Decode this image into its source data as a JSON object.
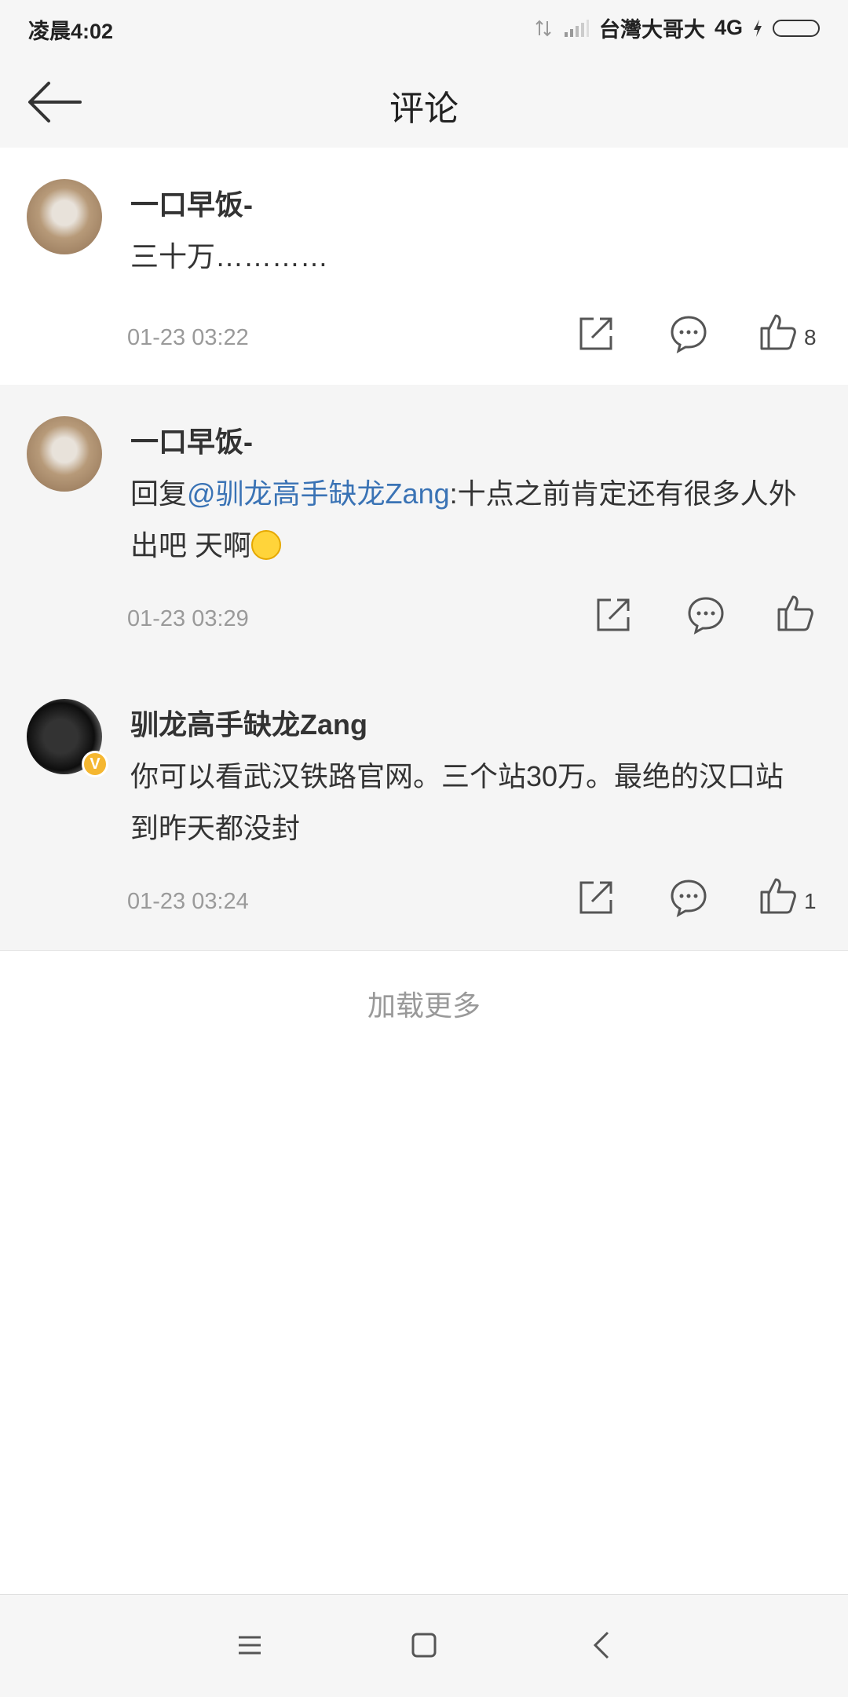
{
  "status_bar": {
    "time": "凌晨4:02",
    "carrier": "台灣大哥大",
    "network": "4G"
  },
  "header": {
    "title": "评论",
    "back_icon": "back-arrow-icon"
  },
  "comments": [
    {
      "username": "一口早饭-",
      "text": "三十万…………",
      "mention": "",
      "timestamp": "01-23 03:22",
      "likes": "8",
      "verified": false
    },
    {
      "username": "一口早饭-",
      "reply_prefix": "回复",
      "mention": "@驯龙高手缺龙Zang",
      "text_after": ":十点之前肯定还有很多人外出吧 天啊",
      "timestamp": "01-23 03:29",
      "likes": "",
      "verified": false
    },
    {
      "username": "驯龙高手缺龙Zang",
      "text": "你可以看武汉铁路官网。三个站30万。最绝的汉口站到昨天都没封",
      "timestamp": "01-23 03:24",
      "likes": "1",
      "verified": true,
      "verified_mark": "V"
    }
  ],
  "load_more": "加载更多",
  "colors": {
    "mention": "#3a73b5",
    "verified_badge": "#f5b731",
    "timestamp": "#9a9a9a"
  },
  "nav_icons": [
    "menu-icon",
    "home-icon",
    "back-icon"
  ]
}
